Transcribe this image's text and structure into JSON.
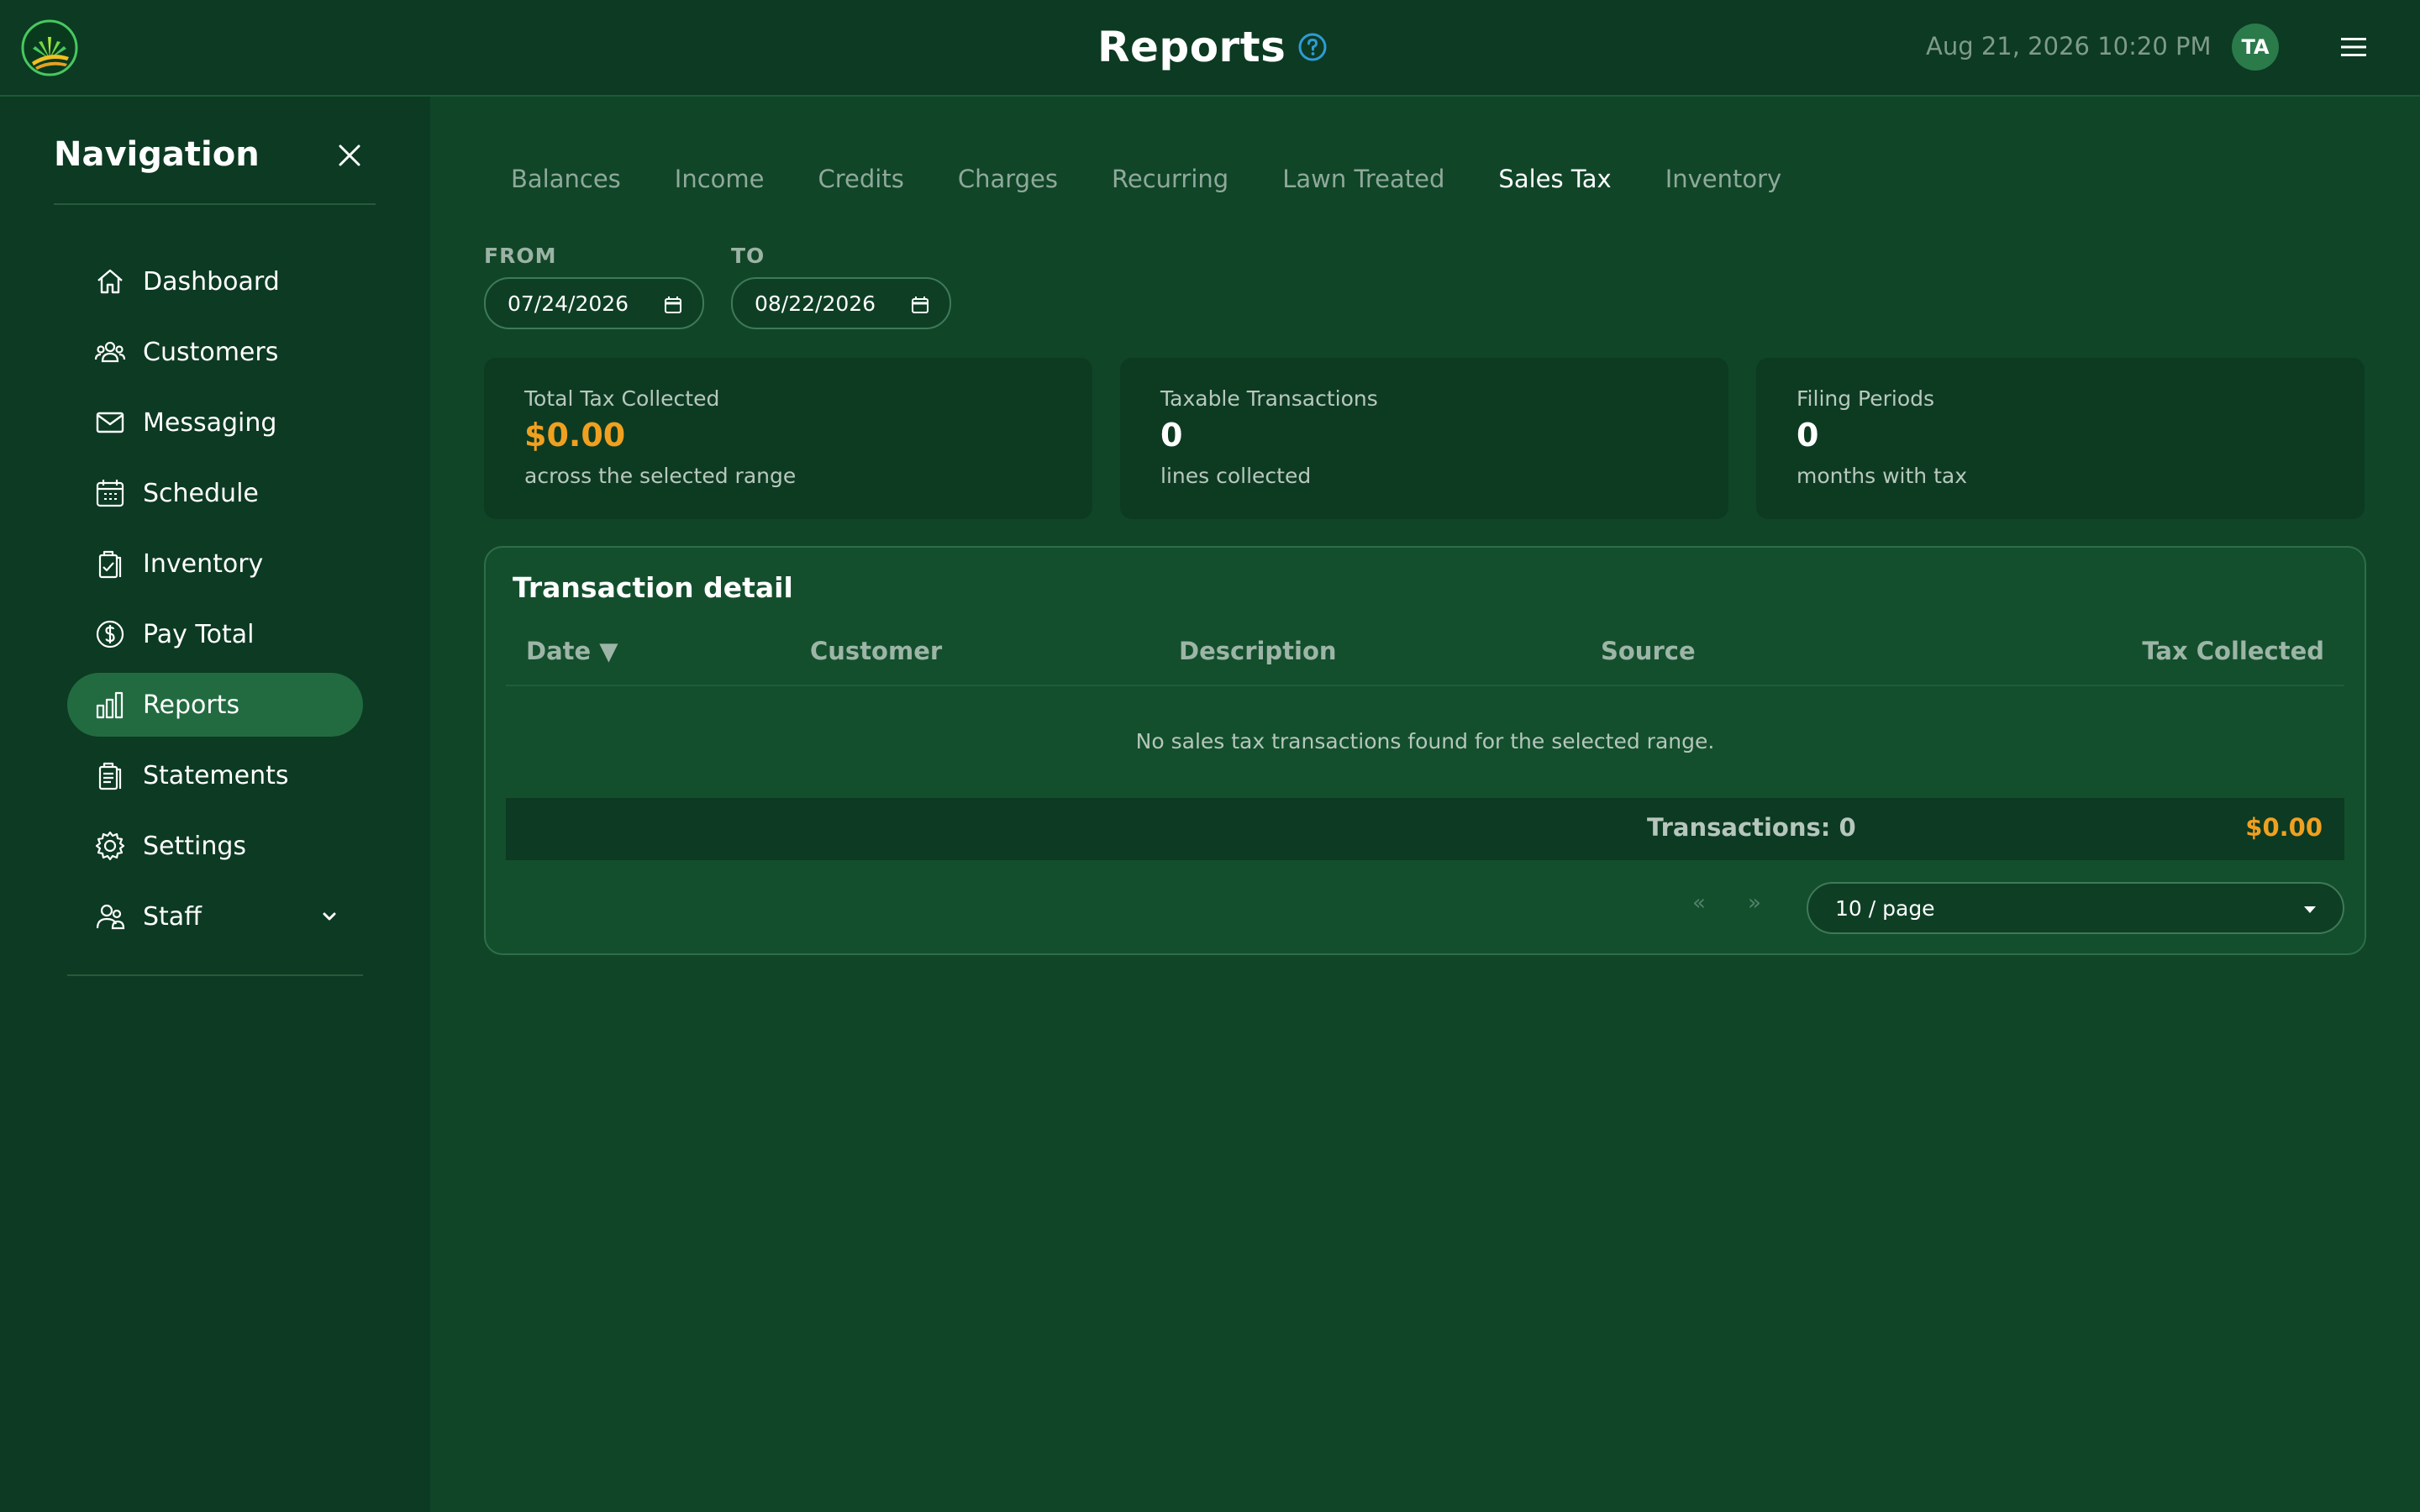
{
  "header": {
    "title": "Reports",
    "datetime": "Aug 21, 2026 10:20 PM",
    "avatar_initials": "TA",
    "icons": [
      "brand-logo-icon",
      "help-circle-icon",
      "hamburger-menu-icon"
    ]
  },
  "sidebar": {
    "title": "Navigation",
    "items": [
      {
        "label": "Dashboard",
        "icon": "home-icon"
      },
      {
        "label": "Customers",
        "icon": "users-icon"
      },
      {
        "label": "Messaging",
        "icon": "envelope-icon"
      },
      {
        "label": "Schedule",
        "icon": "calendar-icon"
      },
      {
        "label": "Inventory",
        "icon": "clipboard-check-icon"
      },
      {
        "label": "Pay Total",
        "icon": "dollar-circle-icon"
      },
      {
        "label": "Reports",
        "icon": "bar-chart-icon",
        "active": true
      },
      {
        "label": "Statements",
        "icon": "documents-icon"
      },
      {
        "label": "Settings",
        "icon": "gear-icon"
      },
      {
        "label": "Staff",
        "icon": "staff-icon",
        "has_submenu": true
      }
    ]
  },
  "tabs": [
    {
      "label": "Balances"
    },
    {
      "label": "Income"
    },
    {
      "label": "Credits"
    },
    {
      "label": "Charges"
    },
    {
      "label": "Recurring"
    },
    {
      "label": "Lawn Treated"
    },
    {
      "label": "Sales Tax",
      "active": true
    },
    {
      "label": "Inventory"
    }
  ],
  "filters": {
    "from_label": "FROM",
    "from_value": "07/24/2026",
    "to_label": "TO",
    "to_value": "08/22/2026"
  },
  "stats": [
    {
      "label": "Total Tax Collected",
      "value": "$0.00",
      "sub": "across the selected range"
    },
    {
      "label": "Taxable Transactions",
      "value": "0",
      "sub": "lines collected"
    },
    {
      "label": "Filing Periods",
      "value": "0",
      "sub": "months with tax"
    }
  ],
  "detail": {
    "title": "Transaction detail",
    "columns": [
      "Date ▼",
      "Customer",
      "Description",
      "Source",
      "Tax Collected"
    ],
    "empty_message": "No sales tax transactions found for the selected range.",
    "footer_count": "Transactions: 0",
    "footer_total": "$0.00",
    "pager_prev": "«",
    "pager_next": "»",
    "page_size": "10 / page"
  },
  "colors": {
    "background": "#104528",
    "sidebar": "#0c3a22",
    "active_nav": "#226b40",
    "accent_orange": "#f0a020",
    "help_blue": "#2f9bd6"
  }
}
